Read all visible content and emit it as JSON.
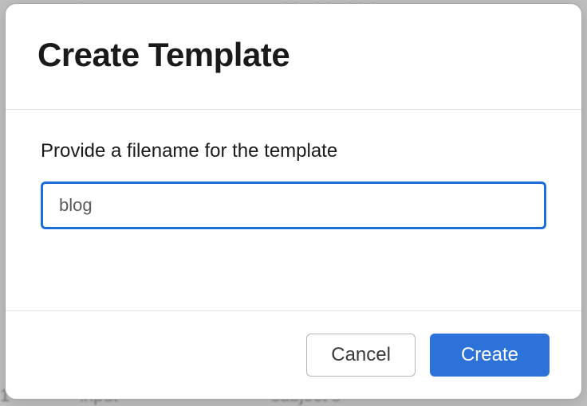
{
  "dialog": {
    "title": "Create Template",
    "prompt": "Provide a filename for the template",
    "input_value": "blog",
    "cancel_label": "Cancel",
    "create_label": "Create"
  },
  "background": {
    "word1": "input",
    "word2": "this this think",
    "word3": "1",
    "word4": "input",
    "word5": "subject s"
  }
}
